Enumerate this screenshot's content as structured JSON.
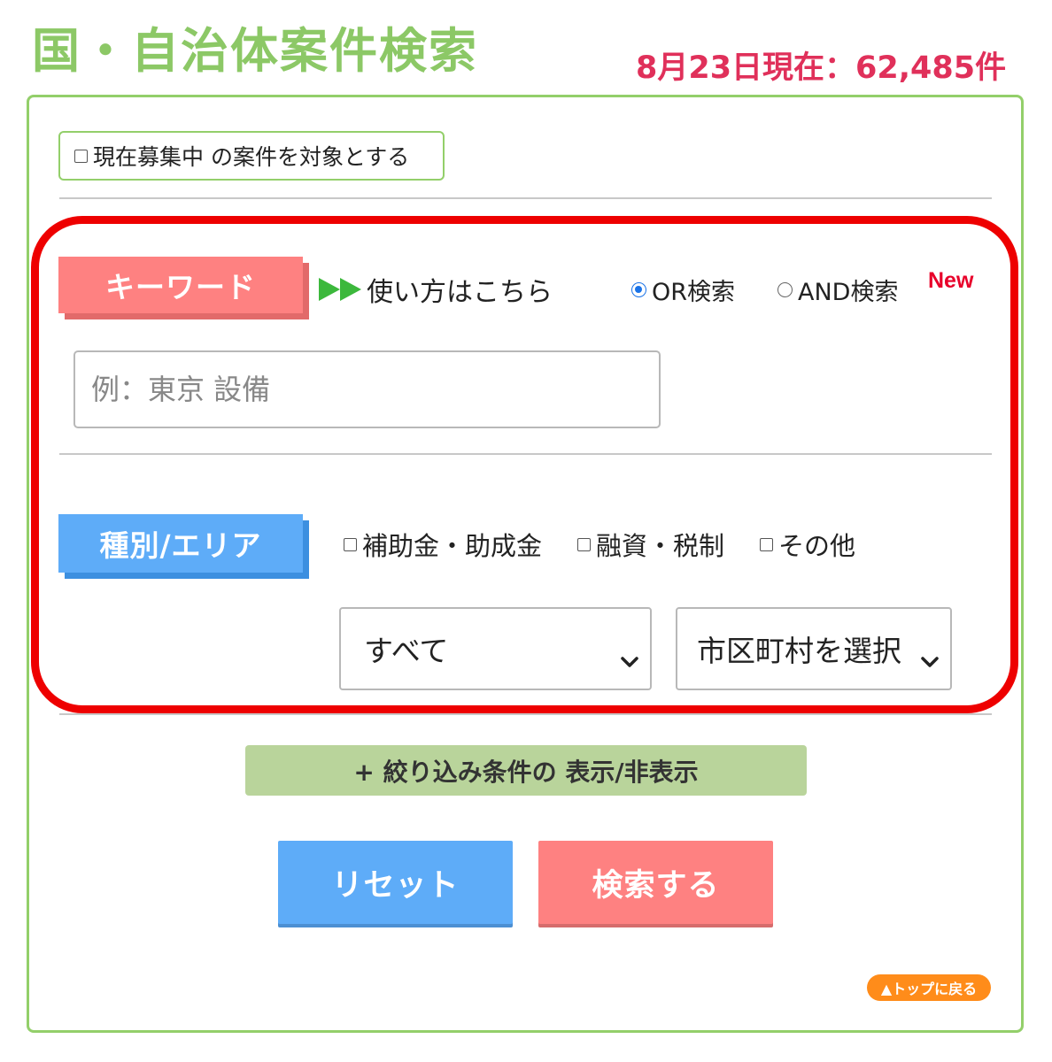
{
  "header": {
    "title": "国・自治体案件検索",
    "count_status": "8月23日現在：62,485件"
  },
  "filters": {
    "open_only_label": "現在募集中 の案件を対象とする"
  },
  "keyword": {
    "section_label": "キーワード",
    "howto_link": "使い方はこちら",
    "or_label": "OR検索",
    "and_label": "AND検索",
    "new_badge": "New",
    "placeholder": "例：東京 設備"
  },
  "area": {
    "section_label": "種別/エリア",
    "checks": [
      "補助金・助成金",
      "融資・税制",
      "その他"
    ],
    "prefecture_selected": "すべて",
    "city_selected": "市区町村を選択"
  },
  "actions": {
    "toggle_filters": "+ 絞り込み条件の 表示/非表示",
    "reset": "リセット",
    "search": "検索する",
    "back_to_top": "▲トップに戻る"
  },
  "colors": {
    "title_green": "#8cc866",
    "count_red": "#e0305a",
    "keyword_pink": "#fe8181",
    "area_blue": "#5eacf8",
    "toggle_green": "#b9d49b",
    "highlight_red": "#ee0000",
    "back_top_orange": "#ff8c1a"
  }
}
